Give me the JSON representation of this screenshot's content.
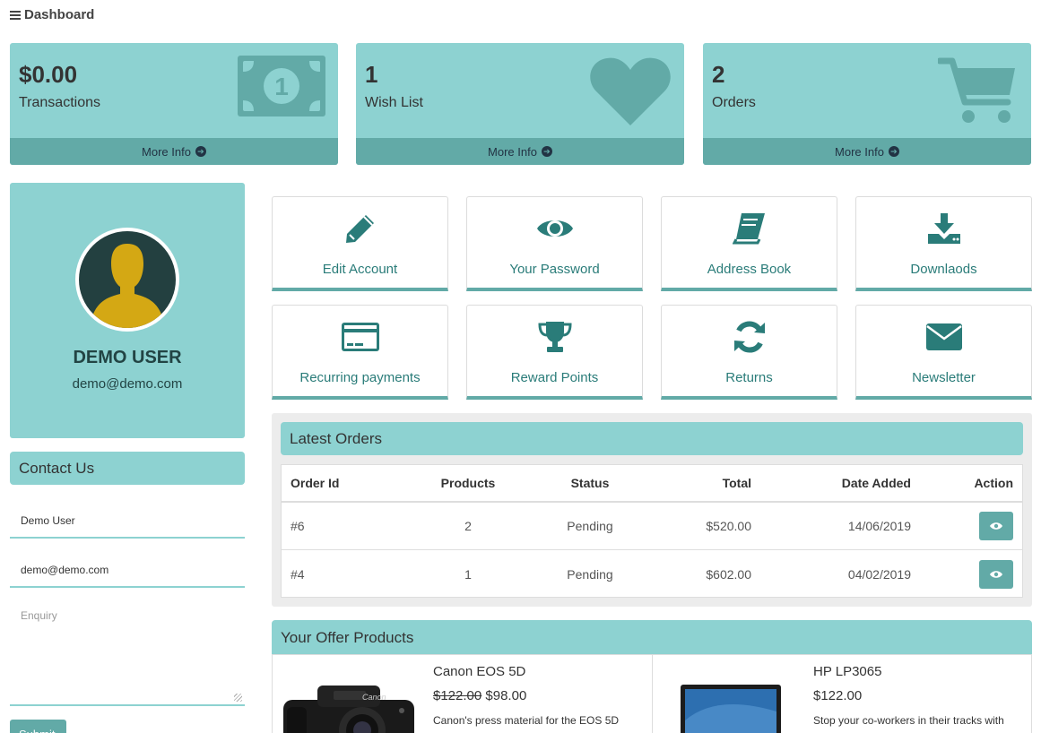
{
  "topbar": {
    "title": "Dashboard"
  },
  "stats": [
    {
      "value": "$0.00",
      "label": "Transactions",
      "more": "More Info",
      "icon": "money-bill-icon"
    },
    {
      "value": "1",
      "label": "Wish List",
      "more": "More Info",
      "icon": "heart-icon"
    },
    {
      "value": "2",
      "label": "Orders",
      "more": "More Info",
      "icon": "shopping-cart-icon"
    }
  ],
  "profile": {
    "name": "DEMO USER",
    "email": "demo@demo.com"
  },
  "contact": {
    "heading": "Contact Us",
    "name_value": "Demo User",
    "email_value": "demo@demo.com",
    "enquiry_placeholder": "Enquiry",
    "submit_label": "Submit"
  },
  "tiles": [
    {
      "label": "Edit Account",
      "icon": "pencil-icon"
    },
    {
      "label": "Your Password",
      "icon": "eye-icon"
    },
    {
      "label": "Address Book",
      "icon": "book-icon"
    },
    {
      "label": "Downlaods",
      "icon": "download-icon"
    },
    {
      "label": "Recurring payments",
      "icon": "credit-card-icon"
    },
    {
      "label": "Reward Points",
      "icon": "trophy-icon"
    },
    {
      "label": "Returns",
      "icon": "refresh-icon"
    },
    {
      "label": "Newsletter",
      "icon": "envelope-icon"
    }
  ],
  "orders": {
    "heading": "Latest Orders",
    "columns": [
      "Order Id",
      "Products",
      "Status",
      "Total",
      "Date Added",
      "Action"
    ],
    "rows": [
      {
        "id": "#6",
        "products": "2",
        "status": "Pending",
        "total": "$520.00",
        "date": "14/06/2019"
      },
      {
        "id": "#4",
        "products": "1",
        "status": "Pending",
        "total": "$602.00",
        "date": "04/02/2019"
      }
    ]
  },
  "offers": {
    "heading": "Your Offer Products",
    "products": [
      {
        "name": "Canon EOS 5D",
        "old_price": "$122.00",
        "price": "$98.00",
        "desc": "Canon's press material for the EOS 5D"
      },
      {
        "name": "HP LP3065",
        "price": "$122.00",
        "desc": "Stop your co-workers in their tracks with"
      }
    ]
  },
  "colors": {
    "teal_light": "#8dd2d1",
    "teal_dark": "#62aaa7",
    "teal_icon": "#2a7c79"
  }
}
